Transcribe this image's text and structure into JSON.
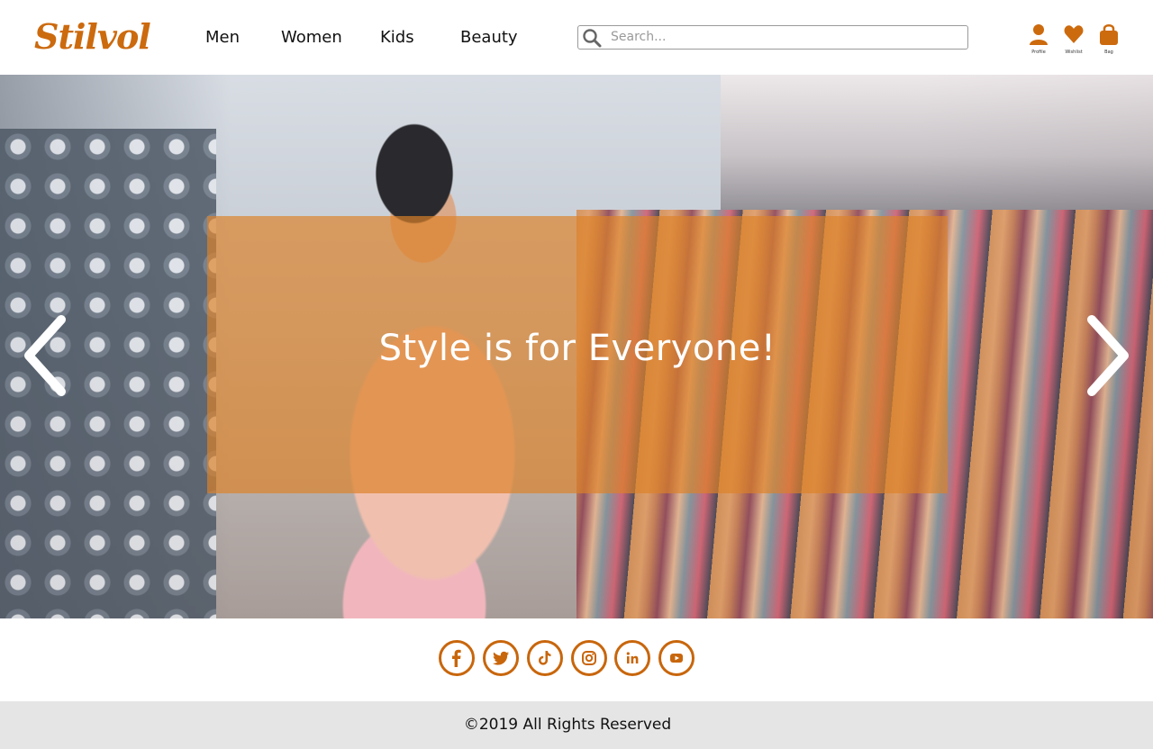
{
  "brand": {
    "logo_text": "Stilvol",
    "accent_color": "#cc6a0e"
  },
  "nav": {
    "items": [
      {
        "label": "Men"
      },
      {
        "label": "Women"
      },
      {
        "label": "Kids"
      },
      {
        "label": "Beauty"
      }
    ]
  },
  "search": {
    "placeholder": "Search...",
    "value": "",
    "icon": "search-icon"
  },
  "header_icons": [
    {
      "icon": "profile-icon",
      "label": "Profile"
    },
    {
      "icon": "heart-icon",
      "label": "Wishlist"
    },
    {
      "icon": "bag-icon",
      "label": "Bag"
    }
  ],
  "hero": {
    "headline": "Style is for Everyone!",
    "prev_icon": "chevron-left-icon",
    "next_icon": "chevron-right-icon"
  },
  "social": [
    {
      "icon": "facebook-icon"
    },
    {
      "icon": "twitter-icon"
    },
    {
      "icon": "tiktok-icon"
    },
    {
      "icon": "instagram-icon"
    },
    {
      "icon": "linkedin-icon"
    },
    {
      "icon": "youtube-icon"
    }
  ],
  "footer": {
    "copyright": "©2019 All Rights Reserved"
  }
}
